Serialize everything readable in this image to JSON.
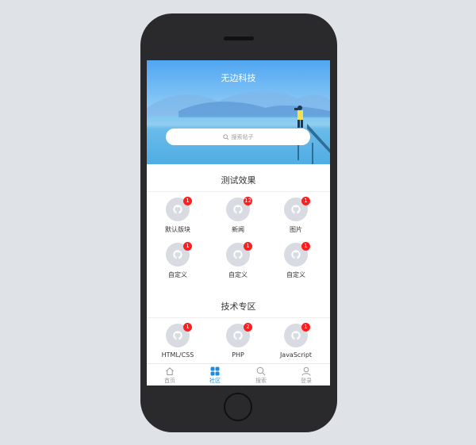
{
  "app": {
    "title": "无边科技"
  },
  "search": {
    "placeholder": "搜索帖子"
  },
  "sections": [
    {
      "title": "测试效果",
      "items": [
        {
          "label": "默认版块",
          "badge": "1"
        },
        {
          "label": "新闻",
          "badge": "12"
        },
        {
          "label": "图片",
          "badge": "1"
        },
        {
          "label": "自定义",
          "badge": "1"
        },
        {
          "label": "自定义",
          "badge": "1"
        },
        {
          "label": "自定义",
          "badge": "1"
        }
      ]
    },
    {
      "title": "技术专区",
      "items": [
        {
          "label": "HTML/CSS",
          "badge": "1"
        },
        {
          "label": "PHP",
          "badge": "2"
        },
        {
          "label": "JavaScript",
          "badge": "1"
        }
      ]
    }
  ],
  "tabbar": {
    "items": [
      {
        "label": "首页",
        "icon": "home-icon"
      },
      {
        "label": "社区",
        "icon": "community-icon",
        "active": true
      },
      {
        "label": "搜索",
        "icon": "search-icon"
      },
      {
        "label": "登录",
        "icon": "user-icon"
      }
    ]
  },
  "colors": {
    "accent": "#1d8ce0",
    "badge": "#ff1e1e",
    "avatar": "#d8dbe2"
  }
}
